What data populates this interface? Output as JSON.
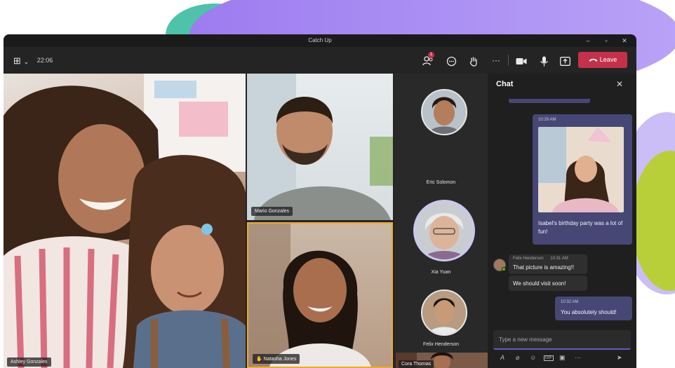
{
  "window": {
    "title": "Catch Up",
    "controls": {
      "minimize": "–",
      "maximize": "▫",
      "close": "✕"
    }
  },
  "toolbar": {
    "layout_icon": "⊞",
    "layout_chevron": "⌄",
    "time": "22:06",
    "participants_badge": "1",
    "more": "···",
    "leave_label": "Leave"
  },
  "participants": {
    "main": "Ashley Gonzales",
    "top_right": "Mario Gonzales",
    "bottom_right": "Natasha Jones",
    "small": "Cora Thomas"
  },
  "roster": [
    {
      "name": "Eric Solomon"
    },
    {
      "name": "Xia Yuan"
    },
    {
      "name": "Felix Henderson"
    }
  ],
  "chat": {
    "title": "Chat",
    "close": "✕",
    "messages": [
      {
        "time": "10:29 AM",
        "text": "Isabel's birthday party was a lot of fun!"
      },
      {
        "sender": "Felix Henderson",
        "time": "10:31 AM",
        "text": "That picture is amazing!!"
      },
      {
        "text": "We should visit soon!"
      },
      {
        "time": "10:32 AM",
        "text": "You absolutely should!"
      }
    ],
    "compose_placeholder": "Type a new message"
  },
  "colors": {
    "leave": "#c4314b",
    "my_bubble": "#464775",
    "accent": "#5b5fc7",
    "speaker_border": "#f0a830"
  },
  "icons": [
    "grid-icon",
    "people-icon",
    "chat-icon",
    "raise-hand-icon",
    "more-icon",
    "camera-icon",
    "mic-icon",
    "share-icon",
    "phone-icon",
    "format-icon",
    "attach-icon",
    "emoji-icon",
    "gif-icon",
    "sticker-icon",
    "send-icon"
  ]
}
